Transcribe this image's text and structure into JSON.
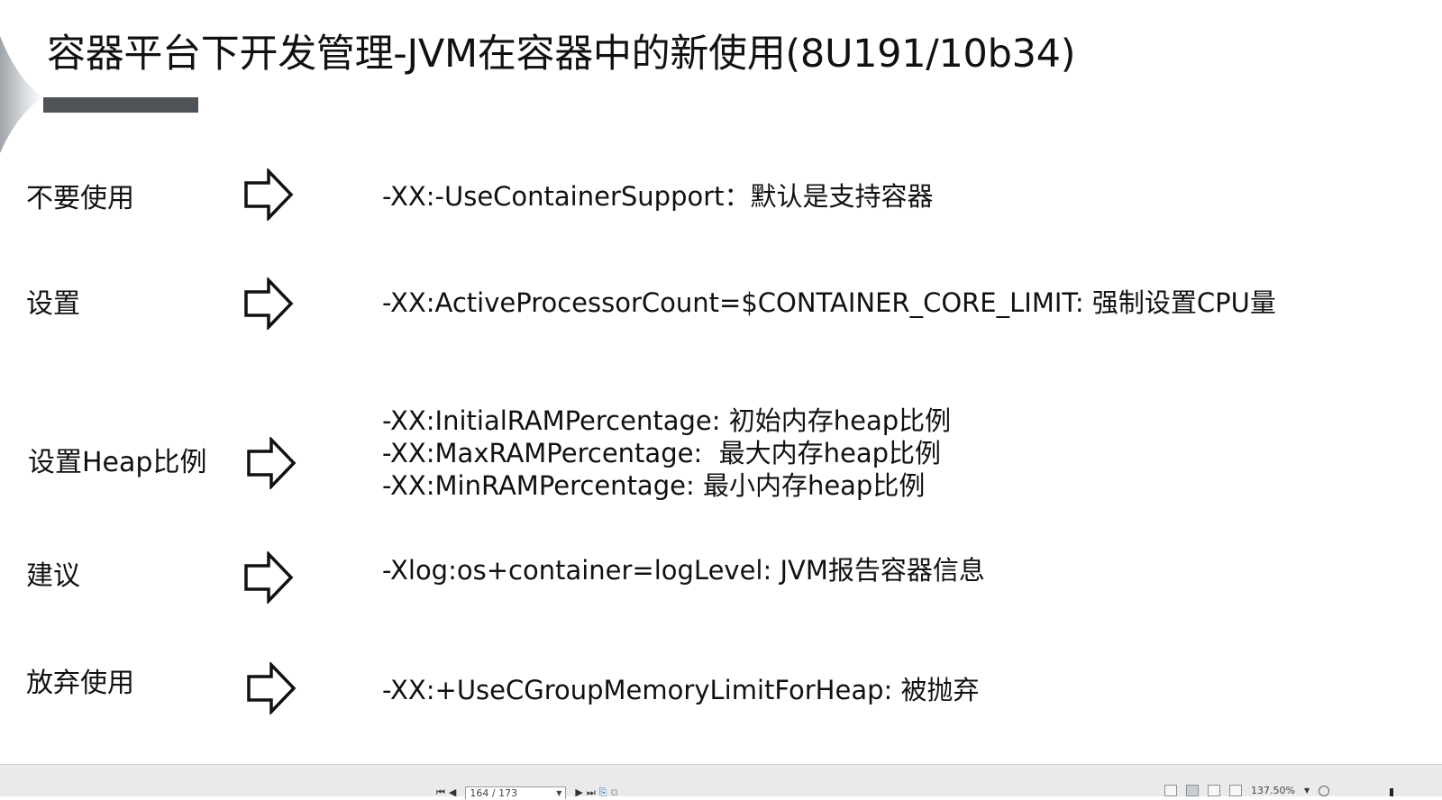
{
  "slide": {
    "title": "容器平台下开发管理-JVM在容器中的新使用(8U191/10b34)",
    "rows": [
      {
        "label": "不要使用",
        "lines": [
          "-XX:-UseContainerSupport：默认是支持容器"
        ]
      },
      {
        "label": "设置",
        "lines": [
          "-XX:ActiveProcessorCount=$CONTAINER_CORE_LIMIT: 强制设置CPU量"
        ]
      },
      {
        "label": "设置Heap比例",
        "lines": [
          "-XX:InitialRAMPercentage: 初始内存heap比例",
          "-XX:MaxRAMPercentage:  最大内存heap比例",
          "-XX:MinRAMPercentage: 最小内存heap比例"
        ]
      },
      {
        "label": "建议",
        "lines": [
          "-Xlog:os+container=logLevel: JVM报告容器信息"
        ]
      },
      {
        "label": "放弃使用",
        "lines": [
          "-XX:+UseCGroupMemoryLimitForHeap: 被抛弃"
        ]
      }
    ]
  },
  "status_bar": {
    "page_indicator": "164 / 173",
    "zoom": "137.50%",
    "nav_icons": [
      "first-page-icon",
      "prev-page-icon",
      "next-page-icon",
      "last-page-icon",
      "goto-page-icon",
      "copy-icon"
    ],
    "view_icons": [
      "single-page-icon",
      "continuous-page-icon",
      "two-page-icon",
      "outline-icon"
    ]
  },
  "colors": {
    "title_bar": "#4e5358",
    "status_bg": "#e9eaeb"
  }
}
